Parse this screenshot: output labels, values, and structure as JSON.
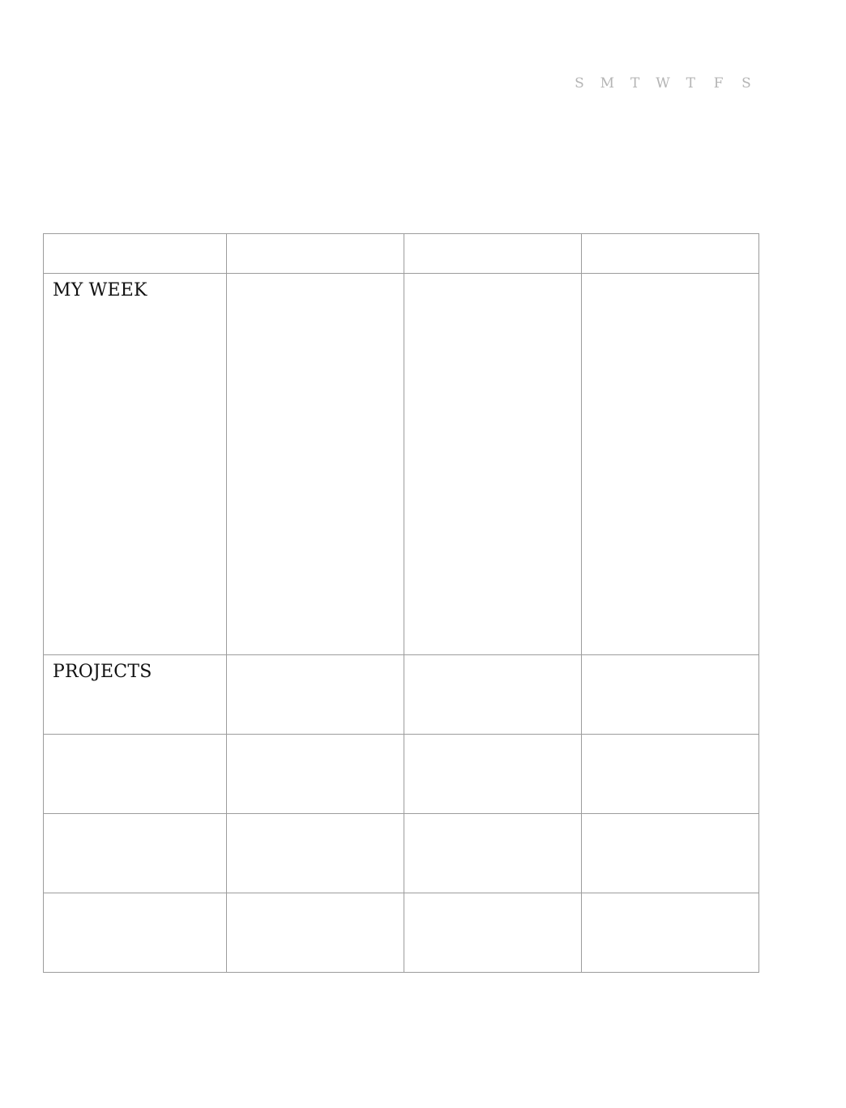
{
  "week_days": [
    "S",
    "M",
    "T",
    "W",
    "T",
    "F",
    "S"
  ],
  "sections": {
    "my_week": "MY WEEK",
    "projects": "PROJECTS"
  },
  "colors": {
    "grid_line": "#9c9c9c",
    "day_letters": "#b4b4b4",
    "text": "#111111",
    "background": "#ffffff"
  }
}
